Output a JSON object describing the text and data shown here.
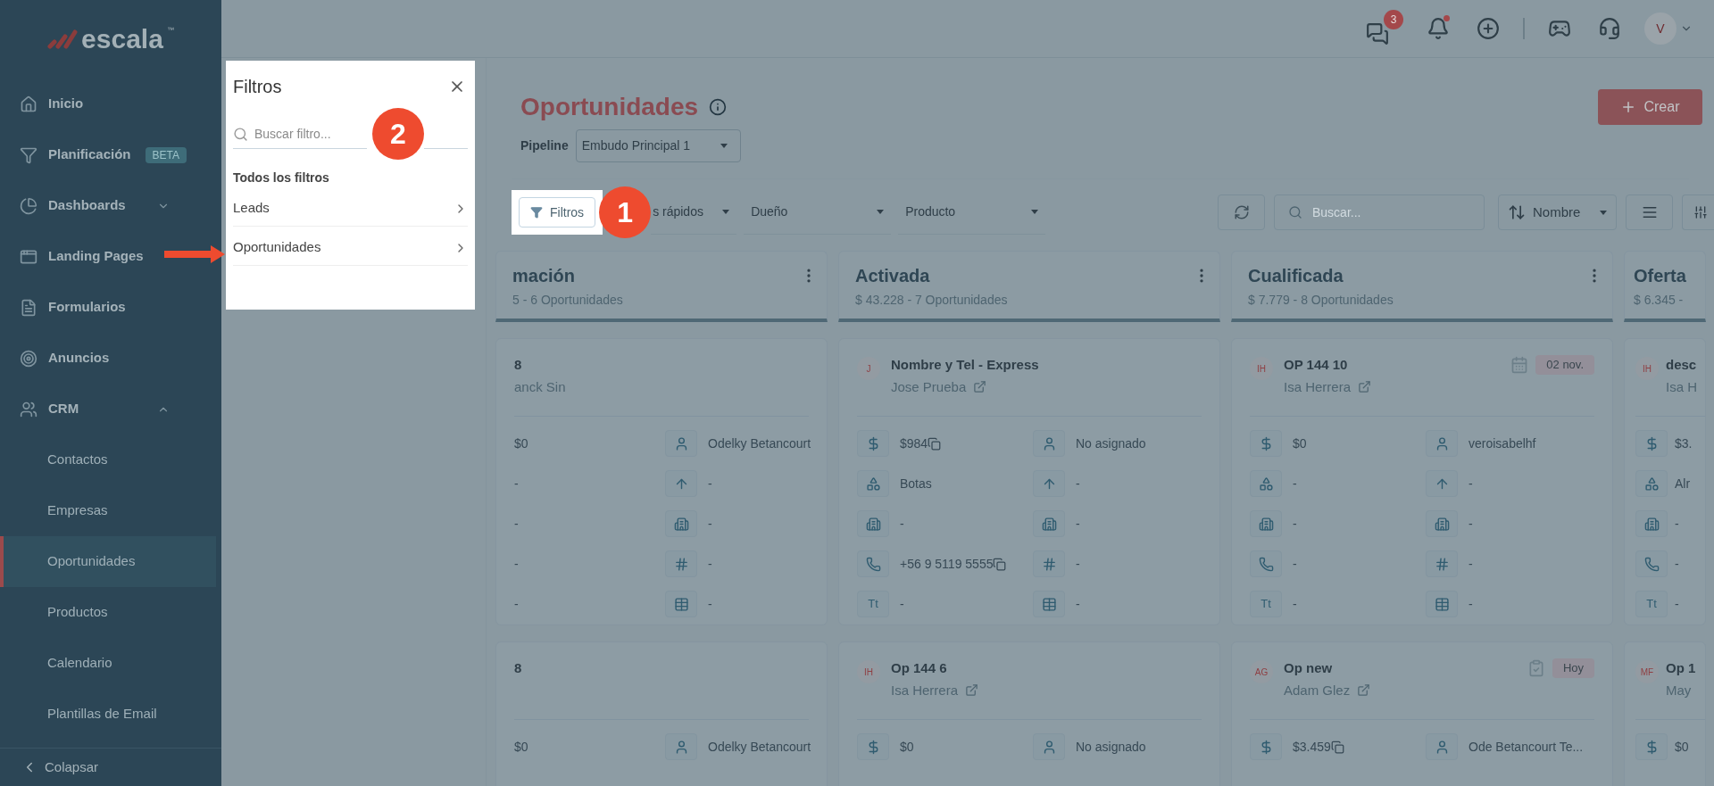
{
  "sidebar": {
    "logo": "escala",
    "trademark": "™",
    "items": [
      {
        "label": "Inicio"
      },
      {
        "label": "Planificación",
        "badge": "BETA"
      },
      {
        "label": "Dashboards",
        "expanded": false
      },
      {
        "label": "Landing Pages"
      },
      {
        "label": "Formularios"
      },
      {
        "label": "Anuncios"
      },
      {
        "label": "CRM",
        "expanded": true,
        "children": [
          {
            "label": "Contactos",
            "selected": false
          },
          {
            "label": "Empresas",
            "selected": false
          },
          {
            "label": "Oportunidades",
            "selected": true
          },
          {
            "label": "Productos",
            "selected": false
          },
          {
            "label": "Calendario",
            "selected": false
          },
          {
            "label": "Plantillas de Email",
            "selected": false
          }
        ]
      }
    ],
    "collapse": "Colapsar"
  },
  "topbar": {
    "chat_badge": "3",
    "bell_unread": true,
    "avatar": "V"
  },
  "filter_panel": {
    "title": "Filtros",
    "placeholder": "Buscar filtro...",
    "section": "Todos los filtros",
    "items": [
      "Leads",
      "Oportunidades"
    ]
  },
  "page": {
    "title": "Oportunidades",
    "create": "Crear",
    "pipeline_label": "Pipeline",
    "pipeline": "Embudo Principal 1"
  },
  "toolbar": {
    "filter_button": "Filtros",
    "dropdowns": [
      "s rápidos",
      "Dueño",
      "Producto"
    ],
    "search_placeholder": "Buscar...",
    "sort": "Nombre"
  },
  "columns": [
    {
      "title": "mación",
      "summary": "5 - 6 Oportunidades",
      "menu_icon": true,
      "cards": [
        {
          "title": "8",
          "subtitle": "anck Sin",
          "external_link": false,
          "rows": [
            [
              {
                "value": "$0"
              },
              {
                "value": "Odelky Betancourt"
              }
            ],
            [
              {
                "value": "-"
              },
              {
                "value": "-"
              }
            ],
            [
              {
                "value": "-"
              },
              {
                "value": "-"
              }
            ],
            [
              {
                "value": "-"
              },
              {
                "value": "-"
              }
            ],
            [
              {
                "value": "-"
              },
              {
                "value": "-"
              }
            ]
          ]
        },
        {
          "title": "8",
          "external_link": false,
          "rows": [
            [
              {
                "value": "$0"
              },
              {
                "value": "Odelky Betancourt"
              }
            ]
          ]
        }
      ]
    },
    {
      "title": "Activada",
      "summary": "$ 43.228 - 7 Oportunidades",
      "menu_icon": true,
      "cards": [
        {
          "avatar": "J",
          "title": "Nombre y Tel - Express",
          "subtitle": "Jose Prueba",
          "external_link": true,
          "rows": [
            [
              {
                "value": "$984",
                "copy": true
              },
              {
                "value": "No asignado"
              }
            ],
            [
              {
                "value": "Botas"
              },
              {
                "value": "-"
              }
            ],
            [
              {
                "value": "-"
              },
              {
                "value": "-"
              }
            ],
            [
              {
                "value": "+56 9 5119 5555",
                "copy": true
              },
              {
                "value": "-"
              }
            ],
            [
              {
                "icon_label": "Tt",
                "value": "-"
              },
              {
                "value": "-"
              }
            ]
          ]
        },
        {
          "avatar": "IH",
          "title": "Op 144 6",
          "subtitle": "Isa Herrera",
          "external_link": true,
          "rows": [
            [
              {
                "value": "$0"
              },
              {
                "value": "No asignado"
              }
            ]
          ]
        }
      ]
    },
    {
      "title": "Cualificada",
      "summary": "$ 7.779 - 8 Oportunidades",
      "menu_icon": true,
      "cards": [
        {
          "avatar": "IH",
          "title": "OP 144 10",
          "subtitle": "Isa Herrera",
          "external_link": true,
          "due": {
            "kind": "date",
            "label": "02 nov."
          },
          "rows": [
            [
              {
                "value": "$0"
              },
              {
                "value": "veroisabelhf"
              }
            ],
            [
              {
                "value": "-"
              },
              {
                "value": "-"
              }
            ],
            [
              {
                "value": "-"
              },
              {
                "value": "-"
              }
            ],
            [
              {
                "value": "-"
              },
              {
                "value": "-"
              }
            ],
            [
              {
                "icon_label": "Tt",
                "value": "-"
              },
              {
                "value": "-"
              }
            ]
          ]
        },
        {
          "avatar": "AG",
          "title": "Op new",
          "subtitle": "Adam Glez",
          "external_link": true,
          "due": {
            "kind": "task",
            "label": "Hoy"
          },
          "rows": [
            [
              {
                "value": "$3.459",
                "copy": true
              },
              {
                "value": "Ode Betancourt Te..."
              }
            ]
          ]
        }
      ]
    },
    {
      "title": "Oferta",
      "summary": "$ 6.345 -",
      "menu_icon": false,
      "cards": [
        {
          "avatar": "IH",
          "title": "desc",
          "subtitle": "Isa H",
          "external_link": false,
          "rows": [
            [
              {
                "value": "$3."
              }
            ],
            [
              {
                "value": "Alr"
              }
            ],
            [
              {
                "value": "-"
              }
            ],
            [
              {
                "value": "-"
              }
            ],
            [
              {
                "icon_label": "Tt",
                "value": "-"
              }
            ]
          ]
        },
        {
          "avatar": "MF",
          "title": "Op 1",
          "subtitle": "May",
          "external_link": false,
          "rows": [
            [
              {
                "value": "$0"
              }
            ]
          ]
        }
      ]
    }
  ],
  "annotations": {
    "markers": [
      "1",
      "2"
    ]
  }
}
